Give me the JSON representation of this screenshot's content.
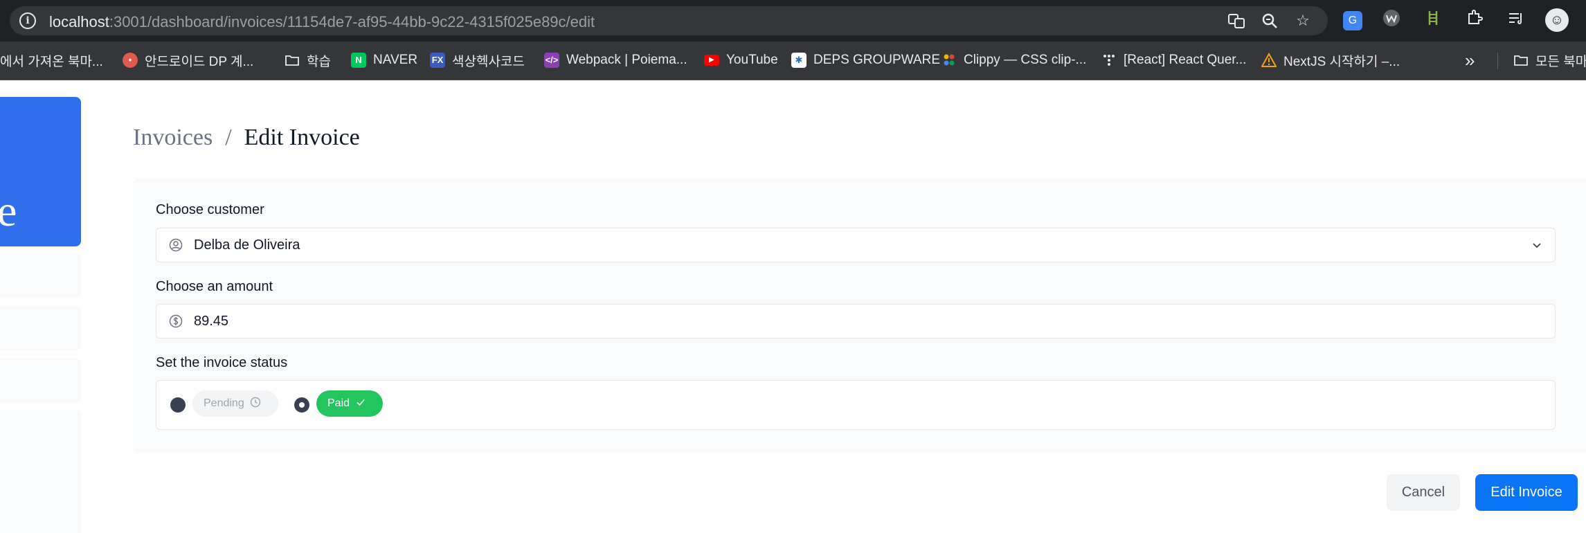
{
  "browser": {
    "url_host": "localhost",
    "url_rest": ":3001/dashboard/invoices/11154de7-af95-44bb-9c22-4315f025e89c/edit",
    "bookmarks": [
      {
        "label": "에서 가져온 북마...",
        "icon": "none"
      },
      {
        "label": "안드로이드 DP 계...",
        "icon": "android-icon"
      },
      {
        "label": "학습",
        "icon": "folder-icon"
      },
      {
        "label": "NAVER",
        "icon": "naver-icon"
      },
      {
        "label": "색상헥사코드",
        "icon": "fx-icon"
      },
      {
        "label": "Webpack | Poiema...",
        "icon": "code-icon"
      },
      {
        "label": "YouTube",
        "icon": "youtube-icon"
      },
      {
        "label": "DEPS GROUPWARE",
        "icon": "deps-icon"
      },
      {
        "label": "Clippy — CSS clip-...",
        "icon": "clippy-icon"
      },
      {
        "label": "[React] React Quer...",
        "icon": "dots-icon"
      },
      {
        "label": "NextJS 시작하기 –...",
        "icon": "warning-icon"
      }
    ],
    "more_bookmarks": "»",
    "other_bookmarks": "모든 북마"
  },
  "sidebar": {
    "logo_letter": "e"
  },
  "breadcrumb": {
    "parent": "Invoices",
    "separator": "/",
    "current": "Edit Invoice"
  },
  "form": {
    "customer": {
      "label": "Choose customer",
      "value": "Delba de Oliveira"
    },
    "amount": {
      "label": "Choose an amount",
      "value": "89.45"
    },
    "status": {
      "label": "Set the invoice status",
      "options": [
        {
          "label": "Pending",
          "icon": "clock-icon",
          "checked": false
        },
        {
          "label": "Paid",
          "icon": "check-icon",
          "checked": true
        }
      ]
    }
  },
  "actions": {
    "cancel": "Cancel",
    "submit": "Edit Invoice"
  },
  "colors": {
    "primary": "#0b74f5",
    "paid": "#22c55e",
    "sidebar_logo": "#2f6feb"
  }
}
